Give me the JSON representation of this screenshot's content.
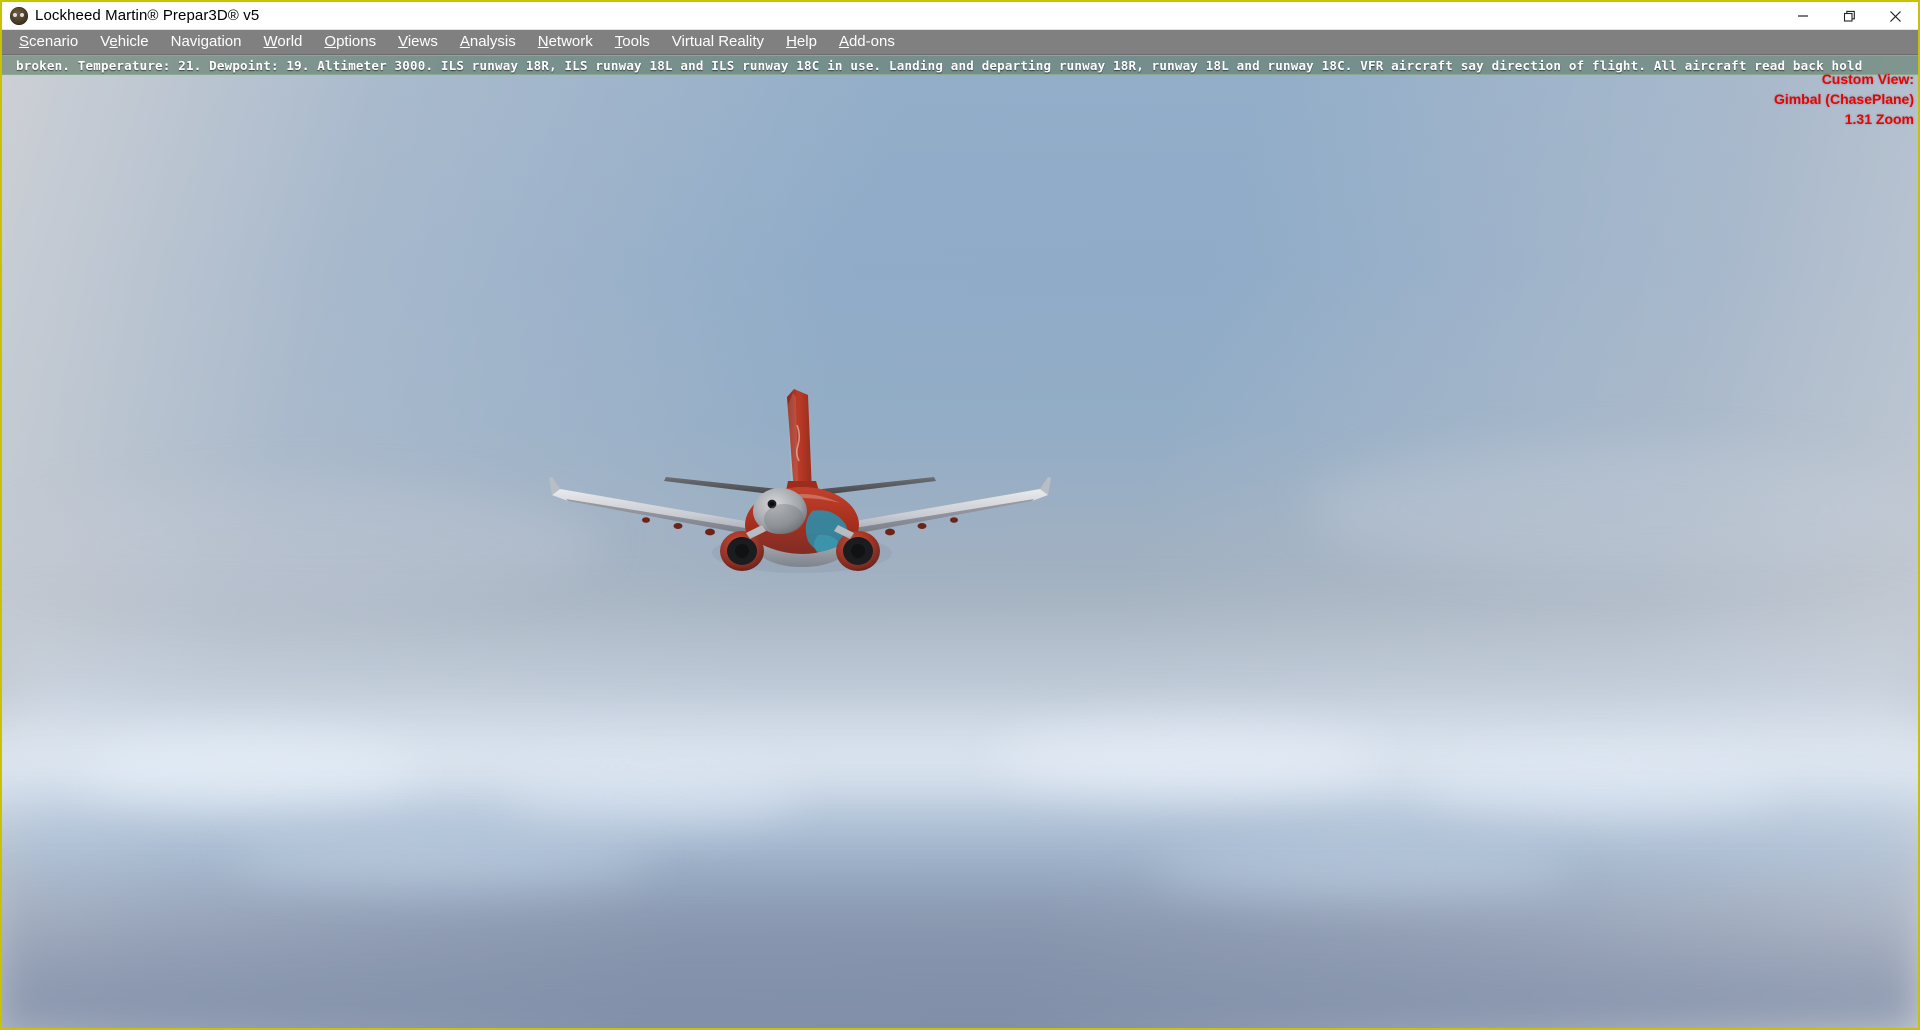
{
  "window": {
    "title": "Lockheed Martin® Prepar3D® v5",
    "icon": "p3d-app-icon",
    "controls": {
      "minimize": "minimize-button",
      "maximize": "maximize-button",
      "close": "close-button"
    }
  },
  "menu": {
    "items": [
      {
        "label": "Scenario",
        "accel": "S"
      },
      {
        "label": "Vehicle",
        "accel": "e"
      },
      {
        "label": "Navigation",
        "accel": "g"
      },
      {
        "label": "World",
        "accel": "W"
      },
      {
        "label": "Options",
        "accel": "O"
      },
      {
        "label": "Views",
        "accel": "V"
      },
      {
        "label": "Analysis",
        "accel": "A"
      },
      {
        "label": "Network",
        "accel": "N"
      },
      {
        "label": "Tools",
        "accel": "T"
      },
      {
        "label": "Virtual Reality",
        "accel": ""
      },
      {
        "label": "Help",
        "accel": "H"
      },
      {
        "label": "Add-ons",
        "accel": "A"
      }
    ]
  },
  "atc": {
    "message": "broken.  Temperature: 21. Dewpoint: 19. Altimeter 3000. ILS runway 18R, ILS runway 18L and ILS runway 18C in use. Landing and departing runway 18R, runway 18L and runway 18C.  VFR aircraft say direction of flight. All aircraft read back hold",
    "background_color": "#5f7a68",
    "text_color": "#ffffff"
  },
  "view_overlay": {
    "title": "Custom View:",
    "camera": "Gimbal (ChasePlane)",
    "zoom": "1.31 Zoom",
    "color": "#ee0000"
  },
  "scene": {
    "subject": "airliner-rear-view",
    "aircraft_livery_primary": "#a8301f",
    "aircraft_livery_accent": "#2d8ea8",
    "sky_color_top": "#93aec9",
    "sky_color_horizon": "#8390a9",
    "cloud_color": "#e2ebf5"
  }
}
